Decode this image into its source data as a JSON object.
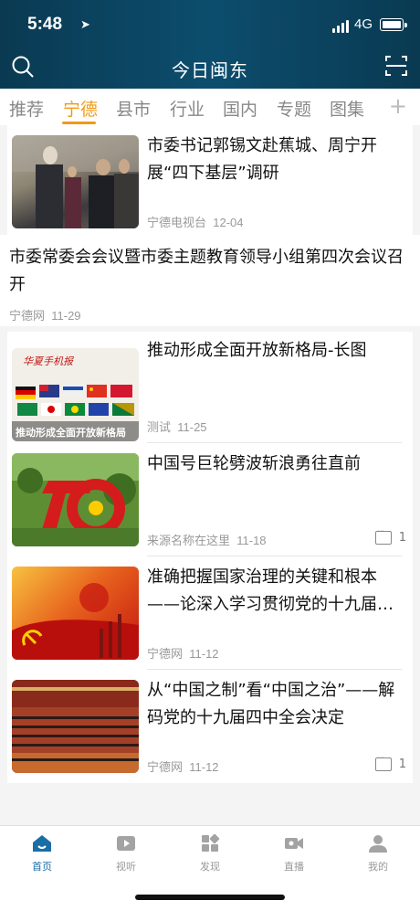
{
  "status": {
    "time": "5:48",
    "network": "4G"
  },
  "header": {
    "title": "今日闽东"
  },
  "tabs": [
    "推荐",
    "宁德",
    "县市",
    "行业",
    "国内",
    "专题",
    "图集"
  ],
  "tabs_plus": "+",
  "articles": [
    {
      "headline": "市委书记郭锡文赴蕉城、周宁开展“四下基层”调研",
      "source": "宁德电视台",
      "date": "12-04"
    },
    {
      "headline": "市委常委会会议暨市委主题教育领导小组第四次会议召开",
      "source": "宁德网",
      "date": "11-29"
    },
    {
      "headline": "推动形成全面开放新格局-长图",
      "source": "测试",
      "date": "11-25",
      "thumb_banner": "推动形成全面开放新格局",
      "thumb_masthead": "华夏手机报"
    },
    {
      "headline": "中国号巨轮劈波斩浪勇往直前",
      "source": "来源名称在这里",
      "date": "11-18",
      "comments": "1"
    },
    {
      "headline": "准确把握国家治理的关键和根本——论深入学习贯彻党的十九届…",
      "source": "宁德网",
      "date": "11-12"
    },
    {
      "headline": "从“中国之制”看“中国之治”——解码党的十九届四中全会决定",
      "source": "宁德网",
      "date": "11-12",
      "comments": "1"
    }
  ],
  "bottom_nav": [
    "首页",
    "视听",
    "发现",
    "直播",
    "我的"
  ],
  "colors": {
    "accent": "#f09a16",
    "header_bg": "#0c4d6d",
    "nav_active": "#1a6ea8"
  }
}
